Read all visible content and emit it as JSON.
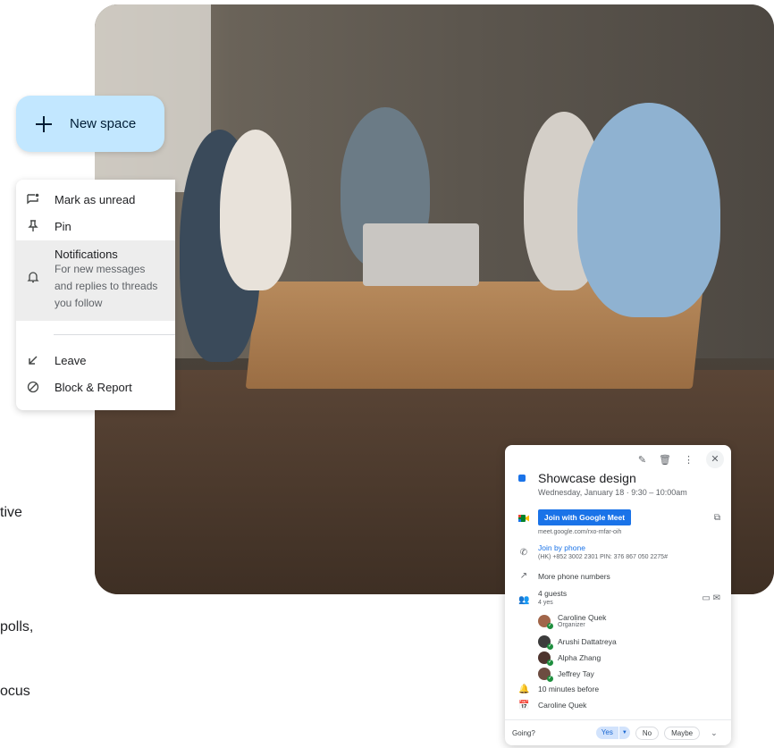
{
  "new_space": {
    "label": "New space"
  },
  "menu": {
    "mark_unread": "Mark as unread",
    "pin": "Pin",
    "notifications": {
      "title": "Notifications",
      "line1": "For new messages",
      "line2": "and replies to threads",
      "line3": "you follow"
    },
    "leave": "Leave",
    "block_report": "Block & Report"
  },
  "left_text": {
    "line1": "tive",
    "line2": "polls,",
    "line3": "ocus"
  },
  "event": {
    "title": "Showcase design",
    "when": "Wednesday, January 18  ·  9:30 – 10:00am",
    "join_label": "Join with Google Meet",
    "meet_link": "meet.google.com/rxo-mfar-oih",
    "join_phone": "Join by phone",
    "phone_detail": "(HK) +852 3002 2301 PIN: 376 867 050 2275#",
    "more_numbers": "More phone numbers",
    "guests_count": "4 guests",
    "guests_yes": "4 yes",
    "guests": [
      {
        "name": "Caroline Quek",
        "role": "Organizer"
      },
      {
        "name": "Arushi Dattatreya",
        "role": ""
      },
      {
        "name": "Alpha Zhang",
        "role": ""
      },
      {
        "name": "Jeffrey Tay",
        "role": ""
      }
    ],
    "reminder": "10 minutes before",
    "calendar_owner": "Caroline Quek",
    "going_label": "Going?",
    "rsvp": {
      "yes": "Yes",
      "no": "No",
      "maybe": "Maybe"
    }
  },
  "colors": {
    "accent": "#1a73e8",
    "new_space_bg": "#c2e7ff",
    "menu_highlight": "#ededed"
  },
  "icons": {
    "mark_unread": "chat-unread-icon",
    "pin": "pin-icon",
    "notifications": "bell-icon",
    "leave": "leave-arrow-icon",
    "block": "block-icon",
    "edit": "pencil-icon",
    "delete": "trash-icon",
    "more": "more-vert-icon",
    "close": "close-icon"
  }
}
